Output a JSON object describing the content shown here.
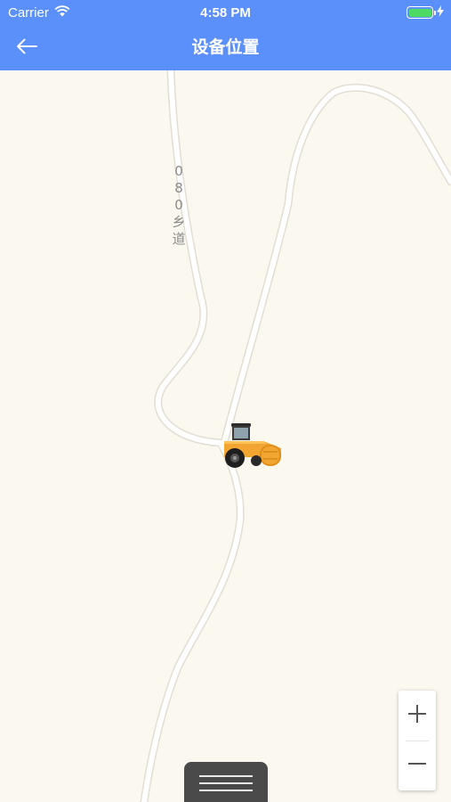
{
  "status_bar": {
    "carrier": "Carrier",
    "time": "4:58 PM",
    "battery_level": 1.0
  },
  "nav": {
    "title": "设备位置",
    "back_icon": "back-arrow-icon"
  },
  "map": {
    "road_label_chars": [
      "0",
      "8",
      "0",
      "乡",
      "道"
    ],
    "marker_icon": "road-roller-icon"
  },
  "zoom": {
    "in_icon": "plus-icon",
    "out_icon": "minus-icon"
  },
  "colors": {
    "header": "#5b8ff9",
    "map_background": "#fbf8ef",
    "road": "#ffffff",
    "road_border": "#e2ded5",
    "vehicle_body": "#f3a531"
  }
}
